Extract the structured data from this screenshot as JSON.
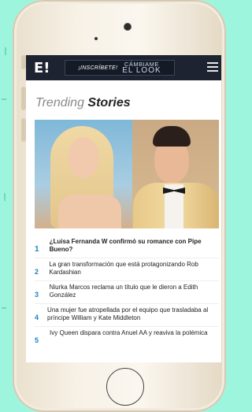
{
  "header": {
    "logo": "E!",
    "promo_cta": "¡INSCRÍBETE!",
    "promo_title_line1": "CÁMBIAME",
    "promo_title_line2": "EL LOOK"
  },
  "section": {
    "title_light": "Trending",
    "title_bold": "Stories"
  },
  "stories": [
    {
      "num": "1",
      "text": "¿Luisa Fernanda W confirmó su romance con Pipe Bueno?"
    },
    {
      "num": "2",
      "text": "La gran transformación que está protagonizando Rob Kardashian"
    },
    {
      "num": "3",
      "text": "Niurka Marcos reclama un título que le dieron a Edith González"
    },
    {
      "num": "4",
      "text": "Una mujer fue atropellada por el equipo que trasladaba al príncipe William y Kate Middleton"
    },
    {
      "num": "5",
      "text": "Ivy Queen dispara contra Anuel AA y reaviva la polémica"
    }
  ],
  "colors": {
    "background": "#9ef5de",
    "topbar": "#1d2330",
    "accent": "#1a84c6"
  }
}
